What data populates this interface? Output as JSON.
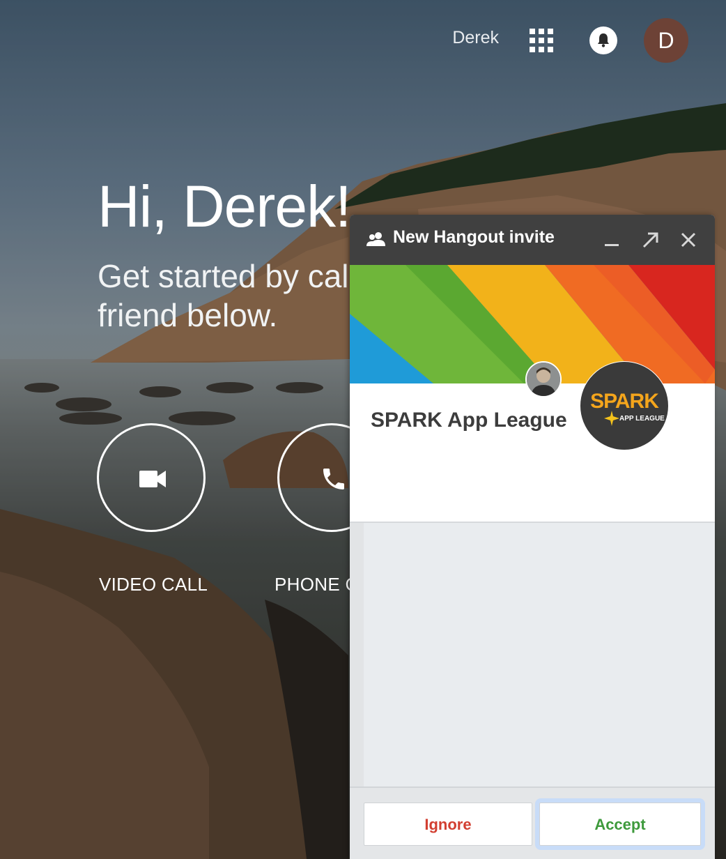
{
  "topbar": {
    "user_name": "Derek",
    "avatar_initial": "D",
    "icons": [
      "apps-grid-icon",
      "bell-icon"
    ]
  },
  "main": {
    "greeting": "Hi, Derek!",
    "subtitle": "Get started by calling a friend below.",
    "calls": [
      {
        "label": "VIDEO CALL",
        "icon": "video-camera-icon"
      },
      {
        "label": "PHONE CALL",
        "icon": "phone-icon"
      }
    ]
  },
  "invite": {
    "title": "New Hangout invite",
    "group_name": "SPARK App League",
    "logo_text": "SPARK",
    "logo_subtext": "APP LEAGUE",
    "header_icons": [
      "people-icon",
      "minimize-icon",
      "popout-icon",
      "close-icon"
    ],
    "ignore_label": "Ignore",
    "accept_label": "Accept",
    "colors": {
      "header": "#404040",
      "ignore": "#d23f31",
      "accept": "#3e9a3c",
      "avatar": "#6d4236"
    }
  }
}
